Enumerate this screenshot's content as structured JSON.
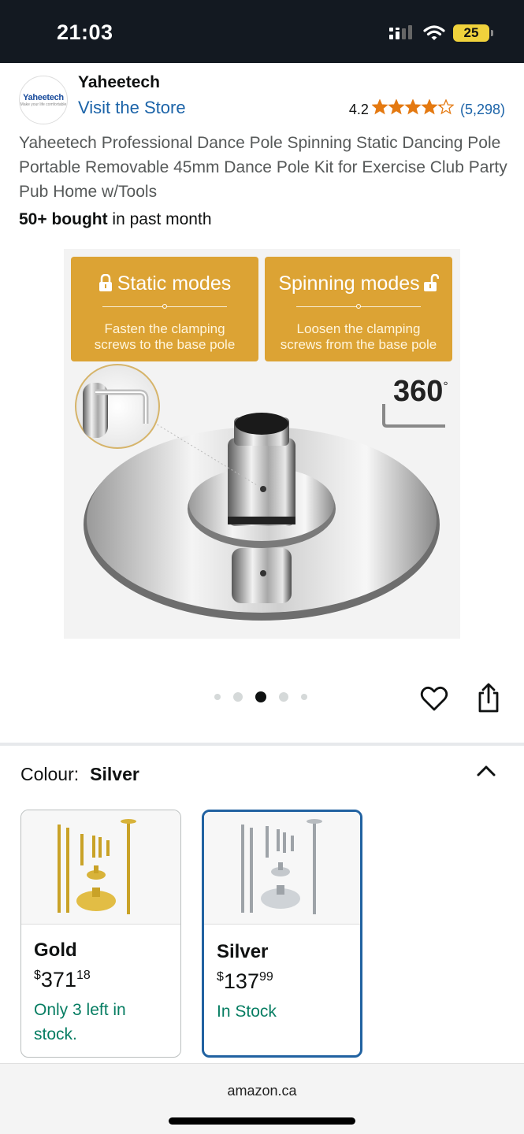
{
  "status_bar": {
    "time": "21:03",
    "battery": "25"
  },
  "brand": {
    "logo_text": "Yaheetech",
    "logo_tagline": "Make your life comfortable",
    "name": "Yaheetech",
    "visit_store": "Visit the Store"
  },
  "rating": {
    "value": "4.2",
    "stars": 4.2,
    "count": "(5,298)"
  },
  "product": {
    "title": "Yaheetech Professional Dance Pole Spinning Static Dancing Pole Portable Removable 45mm Dance Pole Kit for Exercise Club Party Pub Home w/Tools",
    "bought_bold": "50+ bought",
    "bought_rest": " in past month"
  },
  "image": {
    "static_title": "Static modes",
    "static_desc_1": "Fasten the clamping",
    "static_desc_2": "screws to the base pole",
    "spin_title": "Spinning modes",
    "spin_desc_1": "Loosen the clamping",
    "spin_desc_2": "screws from the base pole",
    "degrees": "360",
    "colors": {
      "card": "#dca334"
    }
  },
  "carousel": {
    "count": 5,
    "active_index": 2
  },
  "variation": {
    "label": "Colour:",
    "selected": "Silver",
    "options": [
      {
        "name": "Gold",
        "currency": "$",
        "whole": "371",
        "cents": "18",
        "stock": "Only 3 left in stock."
      },
      {
        "name": "Silver",
        "currency": "$",
        "whole": "137",
        "cents": "99",
        "stock": "In Stock"
      }
    ]
  },
  "footer": {
    "domain": "amazon.ca"
  }
}
